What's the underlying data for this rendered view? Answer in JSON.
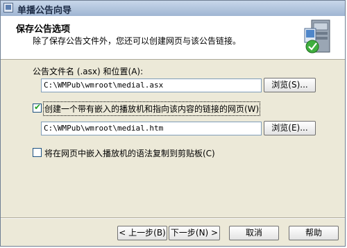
{
  "window": {
    "title": "单播公告向导"
  },
  "header": {
    "title": "保存公告选项",
    "subtitle": "除了保存公告文件外，您还可以创建网页与该公告链接。"
  },
  "announcement_file": {
    "label": "公告文件名 (.asx) 和位置(A):",
    "value": "C:\\WMPub\\wmroot\\medial.asx",
    "browse_label": "浏览(S)..."
  },
  "webpage": {
    "checkbox_label": "创建一个带有嵌入的播放机和指向该内容的链接的网页(W)",
    "checked": true,
    "value": "C:\\WMPub\\wmroot\\medial.htm",
    "browse_label": "浏览(E)..."
  },
  "copy_syntax": {
    "checkbox_label": "将在网页中嵌入播放机的语法复制到剪贴板(C)",
    "checked": false
  },
  "footer": {
    "back_label": "< 上一步(B)",
    "next_label": "下一步(N) >",
    "cancel_label": "取消",
    "help_label": "帮助"
  },
  "icons": {
    "title_icon": "wizard-window-icon",
    "header_icon": "server-with-checkmark-icon"
  }
}
